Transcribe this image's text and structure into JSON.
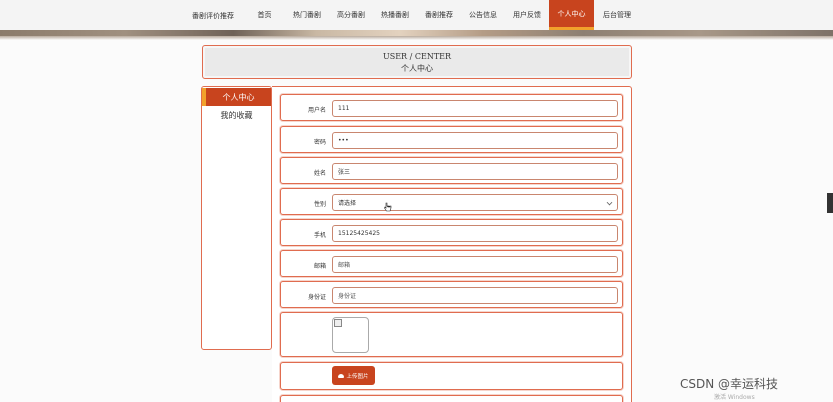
{
  "site_title": "番剧评价推荐",
  "nav": {
    "items": [
      {
        "label": "首页"
      },
      {
        "label": "热门番剧"
      },
      {
        "label": "高分番剧"
      },
      {
        "label": "热播番剧"
      },
      {
        "label": "番剧推荐"
      },
      {
        "label": "公告信息"
      },
      {
        "label": "用户反馈"
      },
      {
        "label": "个人中心"
      },
      {
        "label": "后台管理"
      }
    ],
    "active": "个人中心"
  },
  "header": {
    "title_en": "USER / CENTER",
    "title_cn": "个人中心"
  },
  "sidebar": {
    "items": [
      {
        "label": "个人中心"
      },
      {
        "label": "我的收藏"
      }
    ]
  },
  "form": {
    "username": {
      "label": "用户名",
      "value": "111"
    },
    "password": {
      "label": "密码",
      "value": "•••"
    },
    "name": {
      "label": "姓名",
      "value": "张三"
    },
    "gender": {
      "label": "性别",
      "value": "请选择"
    },
    "phone": {
      "label": "手机",
      "value": "15125425425"
    },
    "email": {
      "label": "邮箱",
      "placeholder": "邮箱"
    },
    "idcard": {
      "label": "身份证",
      "placeholder": "身份证"
    },
    "upload_label": "上传图片"
  },
  "watermark": "CSDN @幸运科技",
  "activate": "激活 Windows",
  "colors": {
    "accent": "#c8441e",
    "accent_bar": "#f2a12c",
    "border": "#e06c4f"
  },
  "icons": [
    "cloud-upload-icon",
    "broken-image-icon",
    "chevron-down-icon",
    "pointer-cursor-icon"
  ]
}
